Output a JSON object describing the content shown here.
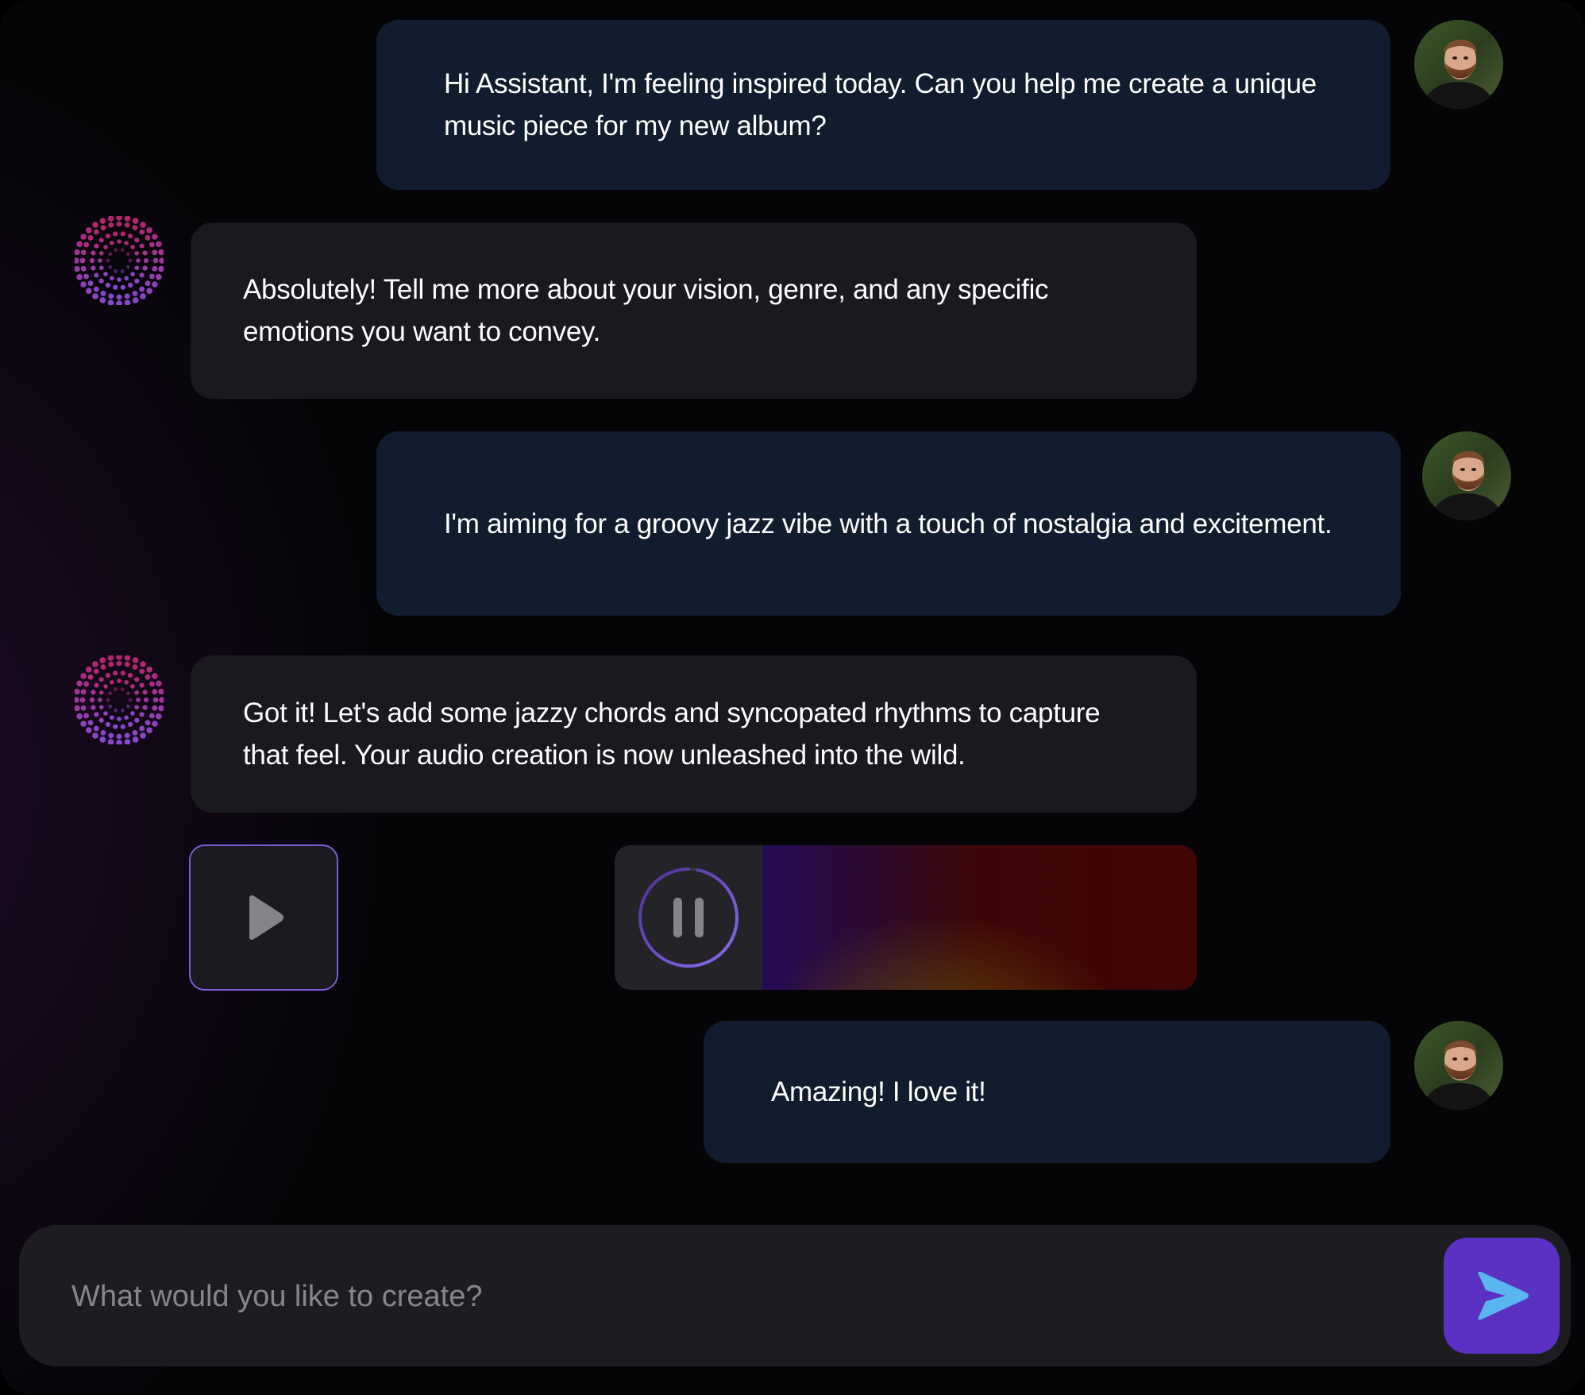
{
  "conversation": {
    "messages": [
      {
        "role": "user",
        "text": "Hi Assistant, I'm feeling inspired today. Can you help me create a unique music piece for my new album?"
      },
      {
        "role": "assistant",
        "text": "Absolutely! Tell me more about your vision, genre, and any specific emotions you want to convey."
      },
      {
        "role": "user",
        "text": "I'm aiming for a groovy jazz vibe with a touch of nostalgia and excitement."
      },
      {
        "role": "assistant",
        "text": "Got it! Let's add some jazzy chords and syncopated rhythms to capture that feel. Your audio creation is now unleashed into the wild."
      },
      {
        "role": "user",
        "text": "Amazing! I love it!"
      }
    ]
  },
  "audio": {
    "play_icon": "play-icon",
    "pause_icon": "pause-icon",
    "progress": 0.97
  },
  "composer": {
    "placeholder": "What would you like to create?",
    "send_icon": "send-arrow-icon"
  },
  "colors": {
    "accent": "#5b31c4",
    "user_bubble": "#111d2f",
    "assistant_bubble": "#1a191e",
    "send_arrow": "#5ab6ee"
  }
}
